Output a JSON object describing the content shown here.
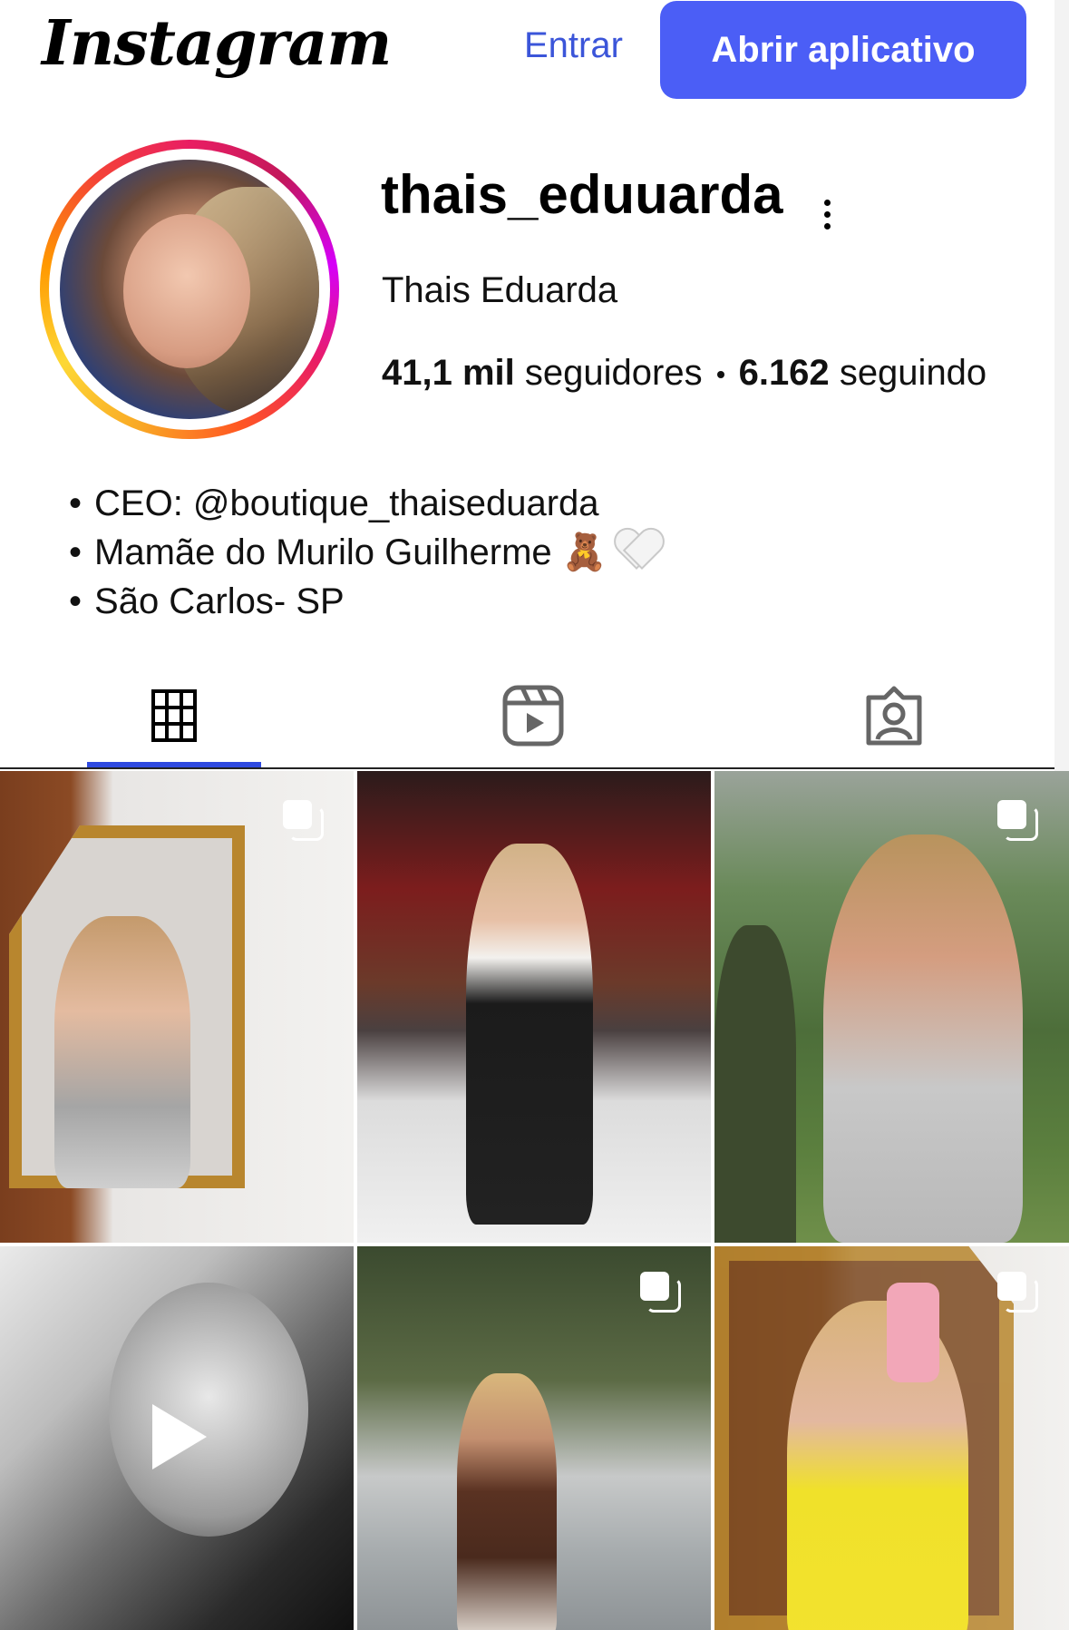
{
  "header": {
    "logo": "Instagram",
    "login_label": "Entrar",
    "open_app_label": "Abrir aplicativo"
  },
  "profile": {
    "username": "thais_eduuarda",
    "full_name": "Thais Eduarda",
    "followers_count": "41,1 mil",
    "followers_label": "seguidores",
    "following_count": "6.162",
    "following_label": "seguindo",
    "bio": [
      "CEO: @boutique_thaiseduarda",
      "Mamãe do Murilo Guilherme 🧸",
      "São Carlos- SP"
    ]
  },
  "tabs": [
    {
      "name": "posts",
      "icon": "grid-icon",
      "active": true
    },
    {
      "name": "reels",
      "icon": "reels-icon",
      "active": false
    },
    {
      "name": "tagged",
      "icon": "tagged-icon",
      "active": false
    }
  ],
  "posts": [
    {
      "type": "carousel",
      "icon": "multiple-photos-icon"
    },
    {
      "type": "photo"
    },
    {
      "type": "carousel",
      "icon": "multiple-photos-icon"
    },
    {
      "type": "video",
      "icon": "play-icon"
    },
    {
      "type": "carousel",
      "icon": "multiple-photos-icon"
    },
    {
      "type": "carousel",
      "icon": "multiple-photos-icon"
    }
  ],
  "colors": {
    "accent": "#4b5ef6",
    "link": "#3b55d9",
    "active_tab": "#2f4ae0"
  }
}
